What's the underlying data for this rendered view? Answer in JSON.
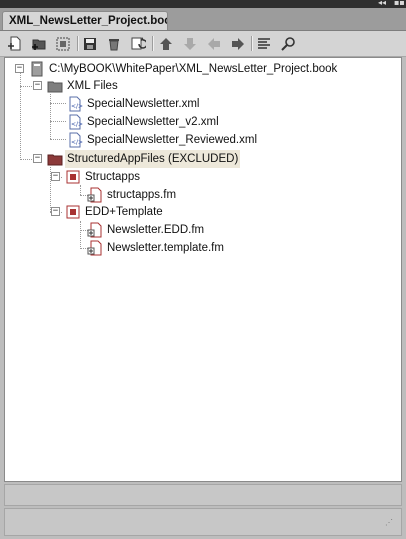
{
  "window": {
    "tab_title": "XML_NewsLetter_Project.book",
    "controls": [
      "◂◂",
      "▪▪"
    ]
  },
  "toolbar": {
    "buttons": [
      {
        "name": "add-file-icon"
      },
      {
        "name": "add-folder-icon"
      },
      {
        "name": "add-group-icon"
      },
      {
        "name": "save-icon"
      },
      {
        "name": "delete-icon"
      },
      {
        "name": "refresh-icon"
      },
      {
        "name": "move-up-icon"
      },
      {
        "name": "move-down-icon"
      },
      {
        "name": "move-left-icon"
      },
      {
        "name": "move-right-icon"
      },
      {
        "name": "list-icon"
      },
      {
        "name": "search-icon"
      }
    ]
  },
  "tree": {
    "root": {
      "label": "C:\\MyBOOK\\WhitePaper\\XML_NewsLetter_Project.book"
    },
    "xml_files": {
      "label": "XML Files",
      "items": [
        {
          "label": "SpecialNewsletter.xml"
        },
        {
          "label": "SpecialNewsletter_v2.xml"
        },
        {
          "label": "SpecialNewsletter_Reviewed.xml"
        }
      ]
    },
    "structured": {
      "label": "StructuredAppFiles (EXCLUDED)",
      "structapps": {
        "label": "Structapps",
        "items": [
          {
            "label": "structapps.fm"
          }
        ]
      },
      "edd": {
        "label": "EDD+Template",
        "items": [
          {
            "label": "Newsletter.EDD.fm"
          },
          {
            "label": "Newsletter.template.fm"
          }
        ]
      }
    }
  },
  "colors": {
    "folder_gray": "#7f7f7f",
    "folder_red": "#8c3a3a",
    "group_red": "#a83232",
    "excluded_highlight": "#ede8da"
  }
}
